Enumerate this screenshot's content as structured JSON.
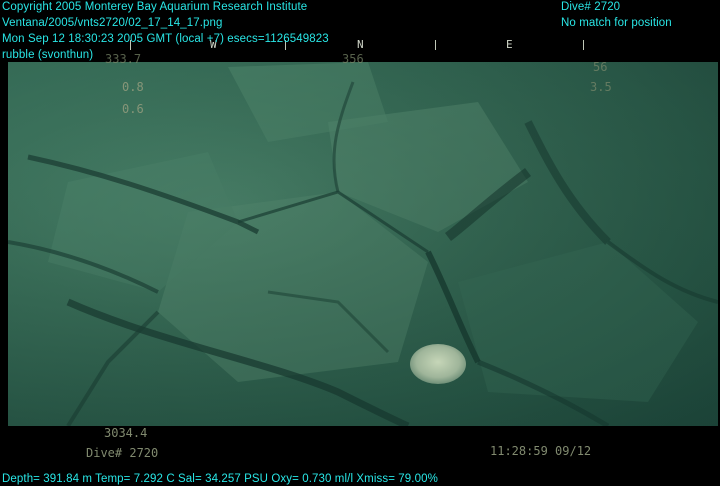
{
  "header": {
    "copyright": "Copyright 2005 Monterey Bay Aquarium Research Institute",
    "file_path": "Ventana/2005/vnts2720/02_17_14_17.png",
    "timestamp": "Mon Sep 12 18:30:23 2005 GMT (local +7)  esecs=1126549823",
    "annotation": "rubble (svonthun)",
    "dive_label": "Dive# 2720",
    "position_status": "No match for position"
  },
  "compass": {
    "w_letter": "W",
    "n_letter": "N",
    "e_letter": "E",
    "heading_left": "333.7",
    "heading_center": "356",
    "top_right_value": "56"
  },
  "camera_overlay": {
    "left_line1": "0.8",
    "left_line2": "0.6",
    "right_line2": "3.5",
    "depth_reading": "3034.4",
    "dive_text": "Dive# 2720",
    "clock": "11:28:59 09/12"
  },
  "footer": {
    "telemetry": "Depth= 391.84 m  Temp= 7.292 C  Sal= 34.257 PSU  Oxy= 0.730 ml/l  Xmiss= 79.00%"
  }
}
